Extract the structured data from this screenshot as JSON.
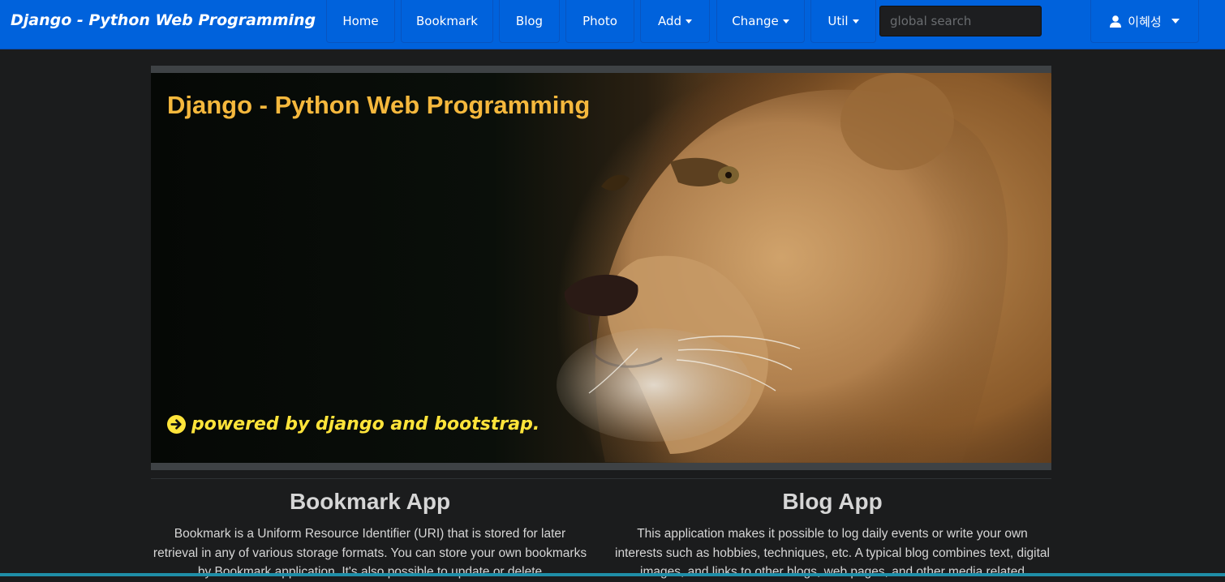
{
  "navbar": {
    "brand": "Django - Python Web Programming",
    "items": [
      {
        "label": "Home",
        "dropdown": false
      },
      {
        "label": "Bookmark",
        "dropdown": false
      },
      {
        "label": "Blog",
        "dropdown": false
      },
      {
        "label": "Photo",
        "dropdown": false
      },
      {
        "label": "Add",
        "dropdown": true
      },
      {
        "label": "Change",
        "dropdown": true
      },
      {
        "label": "Util",
        "dropdown": true
      }
    ],
    "search_placeholder": "global search",
    "user": {
      "name": "이혜성",
      "icon": "user-icon"
    },
    "colors": {
      "background": "#0062dc"
    }
  },
  "hero": {
    "title": "Django - Python Web Programming",
    "tagline": "powered by django and bootstrap.",
    "tagline_icon": "arrow-circle-right-icon",
    "image": "lion-photo",
    "colors": {
      "title": "#f5b83d",
      "tagline": "#ffe43a"
    }
  },
  "apps": [
    {
      "title": "Bookmark App",
      "description": "Bookmark is a Uniform Resource Identifier (URI) that is stored for later retrieval in any of various storage formats. You can store your own bookmarks by Bookmark application. It's also possible to update or delete"
    },
    {
      "title": "Blog App",
      "description": "This application makes it possible to log daily events or write your own interests such as hobbies, techniques, etc. A typical blog combines text, digital images, and links to other blogs, web pages, and other media related"
    }
  ]
}
